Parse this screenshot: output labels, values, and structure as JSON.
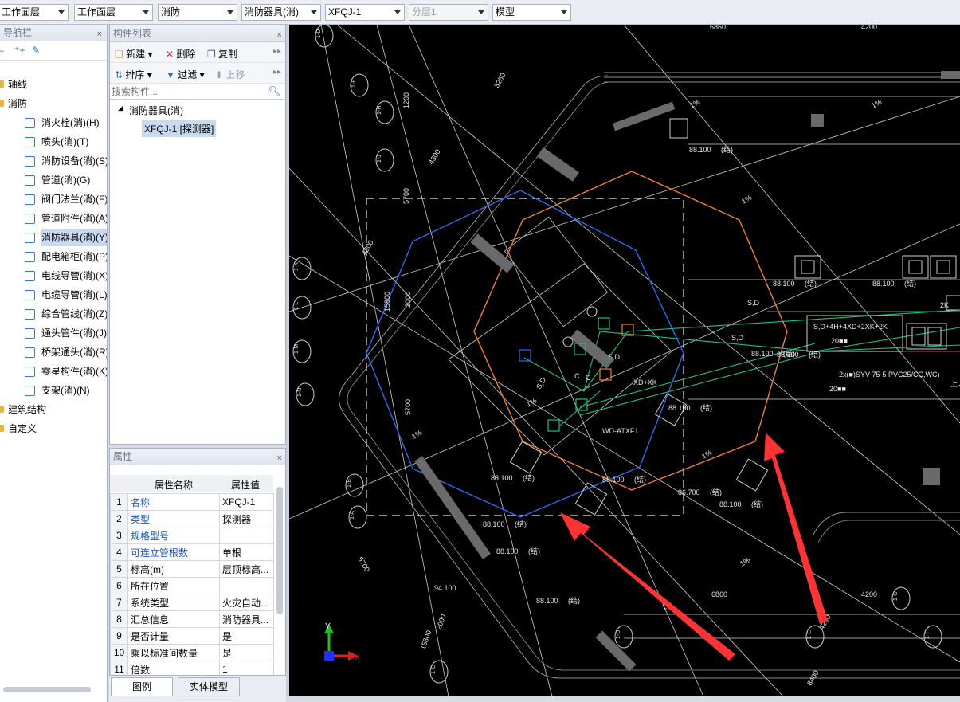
{
  "topbar": {
    "combos": [
      "工作面层",
      "工作面层",
      "消防",
      "消防器具(消)",
      "XFQJ-1",
      "分层1",
      "模型"
    ]
  },
  "nav": {
    "title": "导航栏",
    "close": "×",
    "items": [
      {
        "label": "轴线",
        "type": "folder"
      },
      {
        "label": "消防",
        "type": "folder"
      },
      {
        "label": "消火栓(消)(H)",
        "icon": "hydrant-icon"
      },
      {
        "label": "喷头(消)(T)",
        "icon": "sprinkler-icon"
      },
      {
        "label": "消防设备(消)(S)",
        "icon": "equipment-icon"
      },
      {
        "label": "管道(消)(G)",
        "icon": "pipe-icon"
      },
      {
        "label": "阀门法兰(消)(F)",
        "icon": "valve-icon"
      },
      {
        "label": "管道附件(消)(A)",
        "icon": "pipe-fitting-icon"
      },
      {
        "label": "消防器具(消)(Y)",
        "icon": "fire-device-icon"
      },
      {
        "label": "配电箱柜(消)(P)",
        "icon": "distribution-box-icon"
      },
      {
        "label": "电线导管(消)(X)",
        "icon": "wire-conduit-icon"
      },
      {
        "label": "电缆导管(消)(L)",
        "icon": "cable-conduit-icon"
      },
      {
        "label": "综合管线(消)(Z)",
        "icon": "pipeline-icon"
      },
      {
        "label": "通头管件(消)(J)",
        "icon": "tee-fitting-icon"
      },
      {
        "label": "桥架通头(消)(R)",
        "icon": "tray-fitting-icon"
      },
      {
        "label": "零星构件(消)(K)",
        "icon": "misc-part-icon"
      },
      {
        "label": "支架(消)(N)",
        "icon": "bracket-icon"
      },
      {
        "label": "建筑结构",
        "type": "folder"
      },
      {
        "label": "自定义",
        "type": "folder"
      }
    ]
  },
  "component_list": {
    "title": "构件列表",
    "close": "×",
    "toolbar1": {
      "new": "新建",
      "delete": "删除",
      "copy": "复制"
    },
    "toolbar2": {
      "sort": "排序",
      "filter": "过滤",
      "move_up": "上移"
    },
    "search_placeholder": "搜索构件...",
    "tree": {
      "parent": "消防器具(消)",
      "child": "XFQJ-1 [探测器]"
    }
  },
  "properties": {
    "title": "属性",
    "close": "×",
    "col_name": "属性名称",
    "col_value": "属性值",
    "rows": [
      {
        "n": "1",
        "name": "名称",
        "value": "XFQJ-1",
        "blue": true
      },
      {
        "n": "2",
        "name": "类型",
        "value": "探测器",
        "blue": true
      },
      {
        "n": "3",
        "name": "规格型号",
        "value": "",
        "blue": true
      },
      {
        "n": "4",
        "name": "可连立管根数",
        "value": "单根",
        "blue": true
      },
      {
        "n": "5",
        "name": "标高(m)",
        "value": "层顶标高...",
        "blue": false
      },
      {
        "n": "6",
        "name": "所在位置",
        "value": "",
        "blue": false
      },
      {
        "n": "7",
        "name": "系统类型",
        "value": "火灾自动...",
        "blue": false
      },
      {
        "n": "8",
        "name": "汇总信息",
        "value": "消防器具...",
        "blue": false
      },
      {
        "n": "9",
        "name": "是否计量",
        "value": "是",
        "blue": false
      },
      {
        "n": "10",
        "name": "乘以标准间数量",
        "value": "是",
        "blue": false
      },
      {
        "n": "11",
        "name": "倍数",
        "value": "1",
        "blue": false
      }
    ]
  },
  "tabs": {
    "legend": "图例",
    "solid": "实体模型"
  },
  "cad": {
    "dims": [
      "6860",
      "4200",
      "3250",
      "4300",
      "1200",
      "5700",
      "4300",
      "15800",
      "2000",
      "5700",
      "94.100",
      "2000",
      "15800",
      "5700",
      "6860",
      "4200",
      "8400",
      "4200"
    ],
    "axes": [
      "1-D",
      "1-E",
      "1-H",
      "1-J",
      "1-K",
      "1-L",
      "1-M",
      "1-N",
      "1-B",
      "1-A",
      "1-C",
      "1-D",
      "1-E",
      "1-F",
      "1-G"
    ],
    "elev": [
      "88.100",
      "88.100",
      "88.100",
      "88.100",
      "88.100",
      "88.100",
      "88.100",
      "86.700",
      "88.100",
      "88.100",
      "88.100",
      "88.100",
      "88.100"
    ],
    "elev_tag": "(结)",
    "slope": "1%",
    "labels": {
      "sd": "S,D",
      "sd2": "S,D+4H+4XD+2XK+2K",
      "k2": "2K",
      "xdxk": "XD+XK",
      "cable": "2x(■)SYV-75-5 PVC25/CC,WC)",
      "len1": "20■■",
      "len2": "20■■",
      "wd": "WD-ATXF1",
      "c": "C",
      "upper": "上人屋面"
    },
    "colors": {
      "blue": "#2a6cf0",
      "orange": "#f08030",
      "green": "#1fbf8f",
      "red_arrow": "#ff3030",
      "white": "#e6e6e6"
    }
  }
}
